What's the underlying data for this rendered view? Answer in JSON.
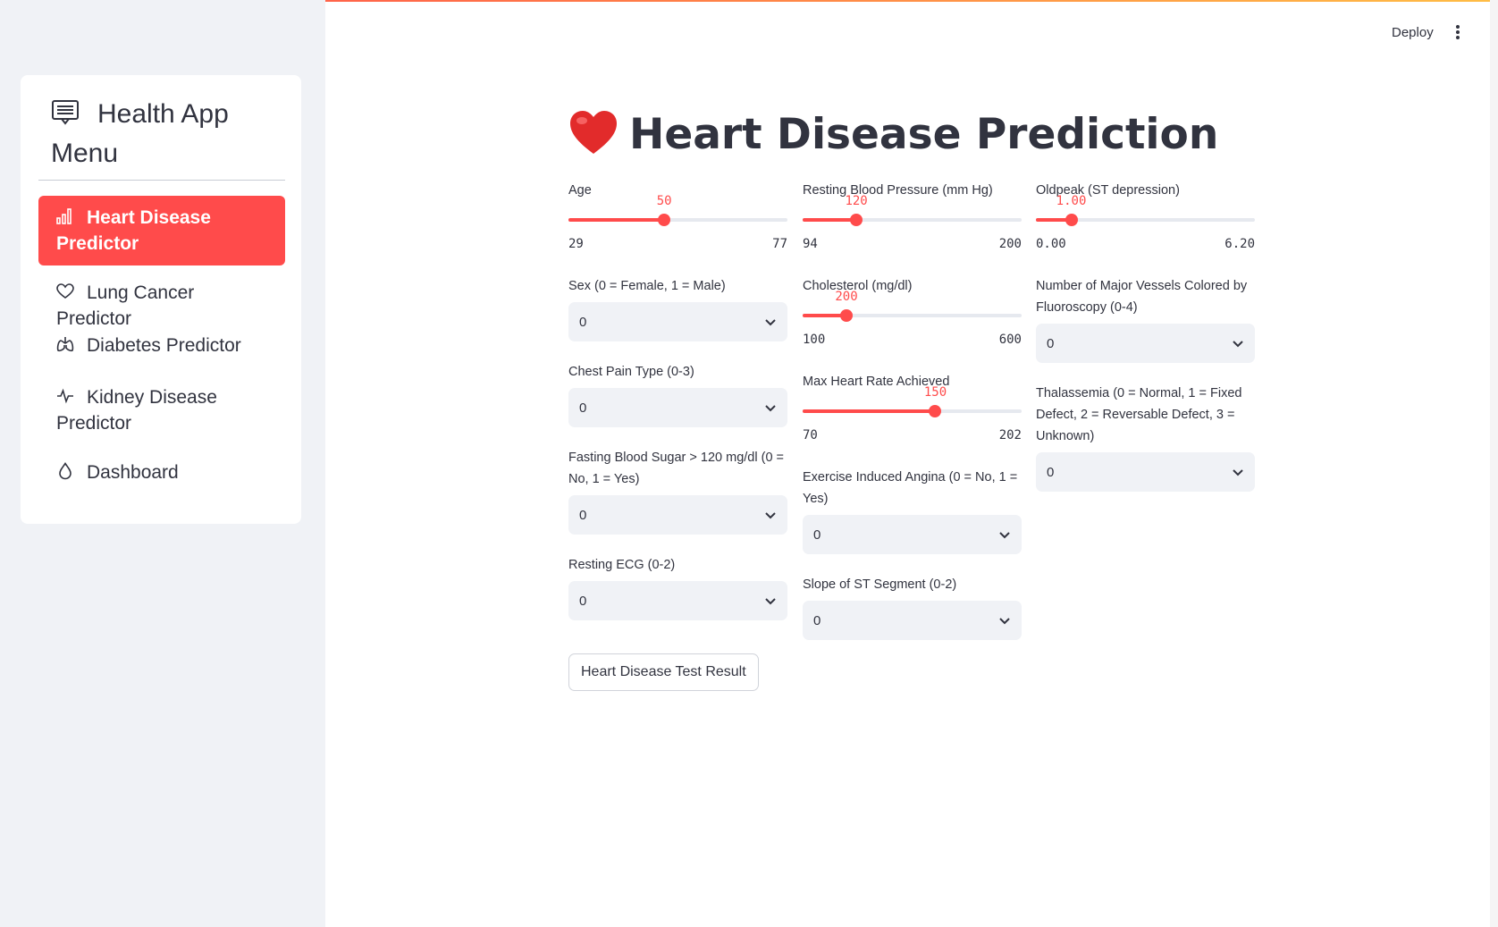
{
  "sidebar": {
    "title": "Health App Menu",
    "title_icon": "menu-app-icon",
    "items": [
      {
        "label": "Heart Disease Predictor",
        "icon": "bar-chart-icon",
        "active": true
      },
      {
        "label": "Lung Cancer Predictor",
        "icon": "heart-outline-icon",
        "active": false
      },
      {
        "label": "Diabetes Predictor",
        "icon": "lungs-icon",
        "active": false
      },
      {
        "label": "Kidney Disease Predictor",
        "icon": "activity-icon",
        "active": false
      },
      {
        "label": "Dashboard",
        "icon": "droplet-icon",
        "active": false
      }
    ]
  },
  "topbar": {
    "deploy": "Deploy",
    "more_icon": "vertical-dots-icon"
  },
  "main": {
    "title": "Heart Disease Prediction",
    "title_icon": "red-heart-emoji",
    "accent_color": "#ff4b4b",
    "fields": {
      "age": {
        "label": "Age",
        "value": "50",
        "min": "29",
        "max": "77"
      },
      "sex": {
        "label": "Sex (0 = Female, 1 = Male)",
        "value": "0"
      },
      "cp": {
        "label": "Chest Pain Type (0-3)",
        "value": "0"
      },
      "fbs": {
        "label": "Fasting Blood Sugar > 120 mg/dl (0 = No, 1 = Yes)",
        "value": "0"
      },
      "restecg": {
        "label": "Resting ECG (0-2)",
        "value": "0"
      },
      "trestbps": {
        "label": "Resting Blood Pressure (mm Hg)",
        "value": "120",
        "min": "94",
        "max": "200"
      },
      "chol": {
        "label": "Cholesterol (mg/dl)",
        "value": "200",
        "min": "100",
        "max": "600"
      },
      "thalach": {
        "label": "Max Heart Rate Achieved",
        "value": "150",
        "min": "70",
        "max": "202"
      },
      "exang": {
        "label": "Exercise Induced Angina (0 = No, 1 = Yes)",
        "value": "0"
      },
      "slope": {
        "label": "Slope of ST Segment (0-2)",
        "value": "0"
      },
      "oldpeak": {
        "label": "Oldpeak (ST depression)",
        "value": "1.00",
        "min": "0.00",
        "max": "6.20"
      },
      "ca": {
        "label": "Number of Major Vessels Colored by Fluoroscopy (0-4)",
        "value": "0"
      },
      "thal": {
        "label": "Thalassemia (0 = Normal, 1 = Fixed Defect, 2 = Reversable Defect, 3 = Unknown)",
        "value": "0"
      }
    },
    "submit_label": "Heart Disease Test Result"
  }
}
